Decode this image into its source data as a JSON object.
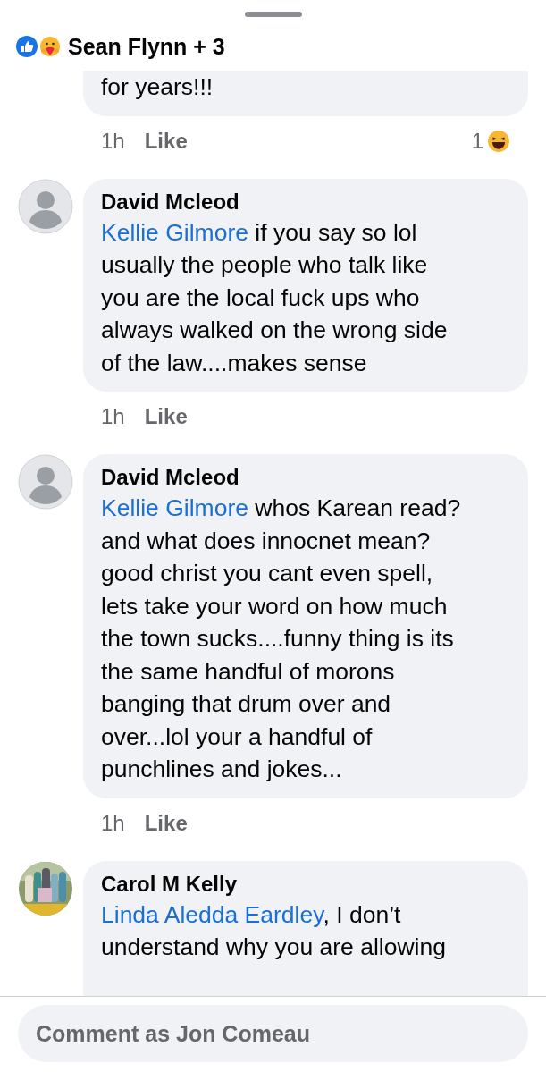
{
  "header": {
    "reactors": "Sean Flynn + 3"
  },
  "comments": [
    {
      "text": "for years!!!",
      "time": "1h",
      "like": "Like",
      "reaction_count": "1"
    },
    {
      "author": "David Mcleod",
      "mention": "Kellie Gilmore",
      "text": " if you say so lol\nusually the people who talk like\nyou are the local fuck ups who\nalways walked on the wrong side\nof the law....makes sense",
      "time": "1h",
      "like": "Like"
    },
    {
      "author": "David Mcleod",
      "mention": "Kellie Gilmore",
      "text": " whos Karean read?\nand what does innocnet mean?\ngood christ you cant even spell,\nlets take your word on how much\nthe town sucks....funny thing is its\nthe same handful of morons\nbanging that drum over and\nover...lol your a handful of\npunchlines and jokes...",
      "time": "1h",
      "like": "Like"
    },
    {
      "author": "Carol M Kelly",
      "mention": "Linda Aledda Eardley",
      "text": ", I don’t\nunderstand why you are allowing"
    }
  ],
  "composer": {
    "placeholder": "Comment as Jon Comeau"
  }
}
